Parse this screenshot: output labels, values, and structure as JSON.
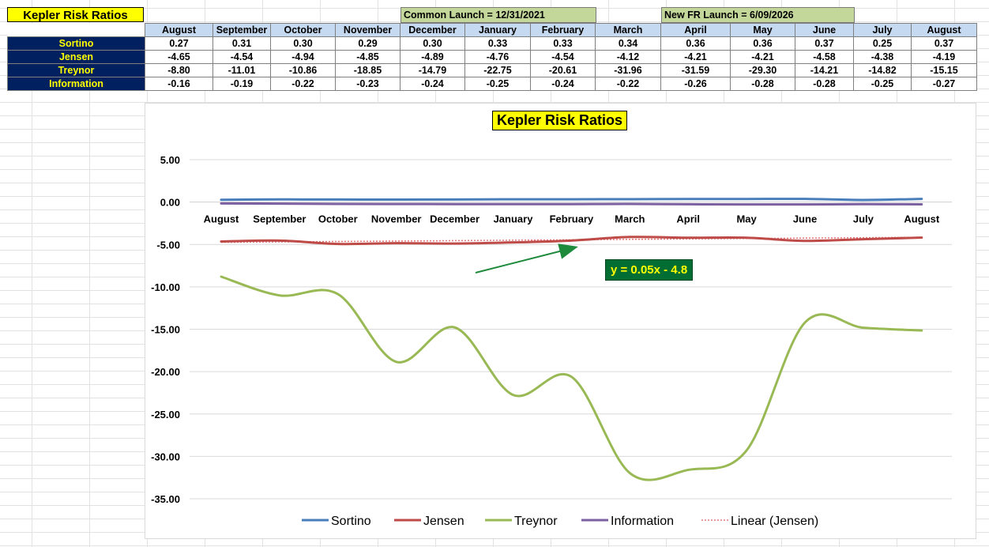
{
  "sheet": {
    "title": "Kepler Risk Ratios",
    "launch_common": "Common Launch = 12/31/2021",
    "launch_new_fr": "New FR Launch = 6/09/2026"
  },
  "table": {
    "months": [
      "August",
      "September",
      "October",
      "November",
      "December",
      "January",
      "February",
      "March",
      "April",
      "May",
      "June",
      "July",
      "August"
    ],
    "rows": [
      {
        "label": "Sortino",
        "values": [
          "0.27",
          "0.31",
          "0.30",
          "0.29",
          "0.30",
          "0.33",
          "0.33",
          "0.34",
          "0.36",
          "0.36",
          "0.37",
          "0.25",
          "0.37"
        ]
      },
      {
        "label": "Jensen",
        "values": [
          "-4.65",
          "-4.54",
          "-4.94",
          "-4.85",
          "-4.89",
          "-4.76",
          "-4.54",
          "-4.12",
          "-4.21",
          "-4.21",
          "-4.58",
          "-4.38",
          "-4.19"
        ]
      },
      {
        "label": "Treynor",
        "values": [
          "-8.80",
          "-11.01",
          "-10.86",
          "-18.85",
          "-14.79",
          "-22.75",
          "-20.61",
          "-31.96",
          "-31.59",
          "-29.30",
          "-14.21",
          "-14.82",
          "-15.15"
        ]
      },
      {
        "label": "Information",
        "values": [
          "-0.16",
          "-0.19",
          "-0.22",
          "-0.23",
          "-0.24",
          "-0.25",
          "-0.24",
          "-0.22",
          "-0.26",
          "-0.28",
          "-0.28",
          "-0.25",
          "-0.27"
        ]
      }
    ]
  },
  "chart_data": {
    "type": "line",
    "title": "Kepler Risk Ratios",
    "categories": [
      "August",
      "September",
      "October",
      "November",
      "December",
      "January",
      "February",
      "March",
      "April",
      "May",
      "June",
      "July",
      "August"
    ],
    "series": [
      {
        "name": "Sortino",
        "color": "#4a7ebb",
        "values": [
          0.27,
          0.31,
          0.3,
          0.29,
          0.3,
          0.33,
          0.33,
          0.34,
          0.36,
          0.36,
          0.37,
          0.25,
          0.37
        ]
      },
      {
        "name": "Jensen",
        "color": "#be4b48",
        "values": [
          -4.65,
          -4.54,
          -4.94,
          -4.85,
          -4.89,
          -4.76,
          -4.54,
          -4.12,
          -4.21,
          -4.21,
          -4.58,
          -4.38,
          -4.19
        ]
      },
      {
        "name": "Treynor",
        "color": "#98b954",
        "values": [
          -8.8,
          -11.01,
          -10.86,
          -18.85,
          -14.79,
          -22.75,
          -20.61,
          -31.96,
          -31.59,
          -29.3,
          -14.21,
          -14.82,
          -15.15
        ]
      },
      {
        "name": "Information",
        "color": "#7d60a0",
        "values": [
          -0.16,
          -0.19,
          -0.22,
          -0.23,
          -0.24,
          -0.25,
          -0.24,
          -0.22,
          -0.26,
          -0.28,
          -0.28,
          -0.25,
          -0.27
        ]
      }
    ],
    "trendline": {
      "name": "Linear (Jensen)",
      "color": "#e07a7a",
      "slope": 0.05,
      "intercept": -4.8,
      "equation": "y = 0.05x - 4.8"
    },
    "ylim": [
      -35,
      5
    ],
    "yticks": [
      "5.00",
      "0.00",
      "-5.00",
      "-10.00",
      "-15.00",
      "-20.00",
      "-25.00",
      "-30.00",
      "-35.00"
    ],
    "grid": true,
    "legend": "bottom"
  }
}
